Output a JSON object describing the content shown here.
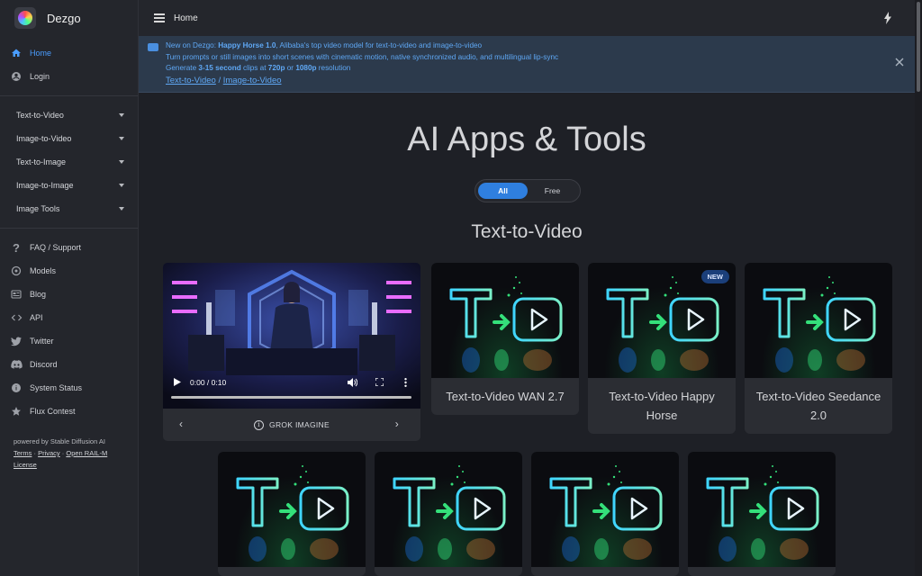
{
  "app": {
    "name": "Dezgo"
  },
  "topbar": {
    "title": "Home"
  },
  "sidebar": {
    "nav_top": [
      {
        "label": "Home",
        "icon": "home-icon",
        "active": true
      },
      {
        "label": "Login",
        "icon": "account-circle-icon",
        "active": false
      }
    ],
    "menus": [
      {
        "label": "Text-to-Video"
      },
      {
        "label": "Image-to-Video"
      },
      {
        "label": "Text-to-Image"
      },
      {
        "label": "Image-to-Image"
      },
      {
        "label": "Image Tools"
      }
    ],
    "links": [
      {
        "label": "FAQ / Support",
        "icon": "question-icon"
      },
      {
        "label": "Models",
        "icon": "models-icon"
      },
      {
        "label": "Blog",
        "icon": "blog-icon"
      },
      {
        "label": "API",
        "icon": "code-icon"
      },
      {
        "label": "Twitter",
        "icon": "twitter-icon"
      },
      {
        "label": "Discord",
        "icon": "discord-icon"
      },
      {
        "label": "System Status",
        "icon": "info-icon"
      },
      {
        "label": "Flux Contest",
        "icon": "star-icon"
      }
    ],
    "footer": {
      "powered": "powered by Stable Diffusion AI",
      "terms": "Terms",
      "sep1": " · ",
      "privacy": "Privacy",
      "sep2": " · ",
      "license_a": "Open RAIL-M",
      "license_b": "License"
    }
  },
  "banner": {
    "line1_prefix": "New on Dezgo: ",
    "line1_bold": "Happy Horse 1.0",
    "line1_suffix": ", Alibaba's top video model for text-to-video and image-to-video",
    "line2": "Turn prompts or still images into short scenes with cinematic motion, native synchronized audio, and multilingual lip-sync",
    "line3_a": "Generate ",
    "line3_b": "3-15 second",
    "line3_c": " clips at ",
    "line3_d": "720p",
    "line3_e": " or ",
    "line3_f": "1080p",
    "line3_g": " resolution",
    "link1": "Text-to-Video",
    "link_sep": " / ",
    "link2": "Image-to-Video"
  },
  "main": {
    "heading": "AI Apps & Tools",
    "filter": {
      "all": "All",
      "free": "Free",
      "selected": "All"
    },
    "section": "Text-to-Video"
  },
  "video": {
    "time": "0:00 / 0:10",
    "caption": "GROK IMAGINE",
    "progress": 0
  },
  "cards": [
    {
      "title": "Text-to-Video WAN 2.7",
      "badge": ""
    },
    {
      "title": "Text-to-Video Happy Horse",
      "badge": "NEW"
    },
    {
      "title": "Text-to-Video Seedance 2.0",
      "badge": ""
    },
    {
      "title": "",
      "badge": ""
    },
    {
      "title": "",
      "badge": ""
    },
    {
      "title": "",
      "badge": ""
    },
    {
      "title": "",
      "badge": ""
    }
  ],
  "colors": {
    "accent": "#2f7fdf",
    "active_nav": "#4a9dff",
    "banner_text": "#5fa8f5",
    "background": "#1e2026"
  }
}
